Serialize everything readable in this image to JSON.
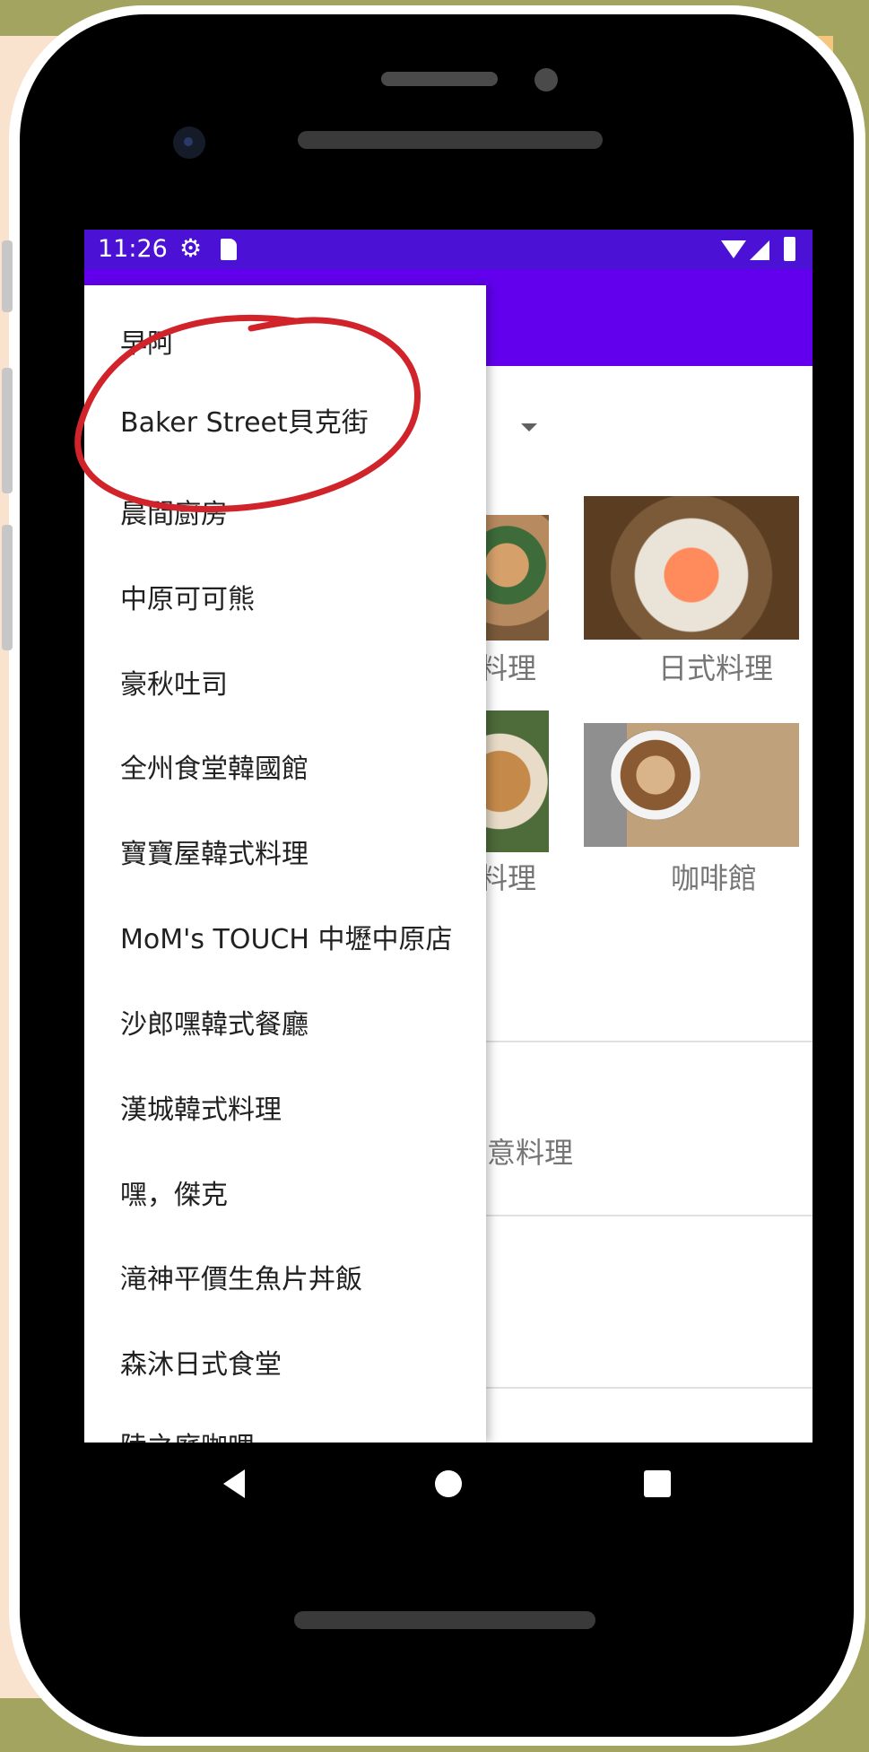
{
  "status_bar": {
    "time": "11:26",
    "icons": [
      "gear-icon",
      "sd-card-icon",
      "wifi-icon",
      "signal-icon",
      "battery-icon"
    ]
  },
  "drawer": {
    "items": [
      "早阿",
      "Baker Street貝克街",
      "晨間廚房",
      "中原可可熊",
      "豪秋吐司",
      "全州食堂韓國館",
      "寶寶屋韓式料理",
      "MoM's TOUCH 中壢中原店",
      "沙郎嘿韓式餐廳",
      "漢城韓式料理",
      "嘿，傑克",
      "滝神平價生魚片丼飯",
      "森沐日式食堂",
      "陸之庭咖哩"
    ],
    "highlighted_item": "Baker Street貝克街"
  },
  "categories": {
    "korean_partial": "料理",
    "japanese": "日式料理",
    "pasta_partial": "料理",
    "cafe": "咖啡館",
    "italian_partial": "意料理"
  },
  "nav_bar": {
    "icons": [
      "back-icon",
      "home-icon",
      "recent-apps-icon"
    ]
  },
  "colors": {
    "status_bar": "#4b12d6",
    "app_bar": "#6200ee",
    "annotation": "#d0232a",
    "background_peach": "#f9e3cf",
    "background_orange": "#f5c77e",
    "background_olive": "#a3a45f"
  }
}
